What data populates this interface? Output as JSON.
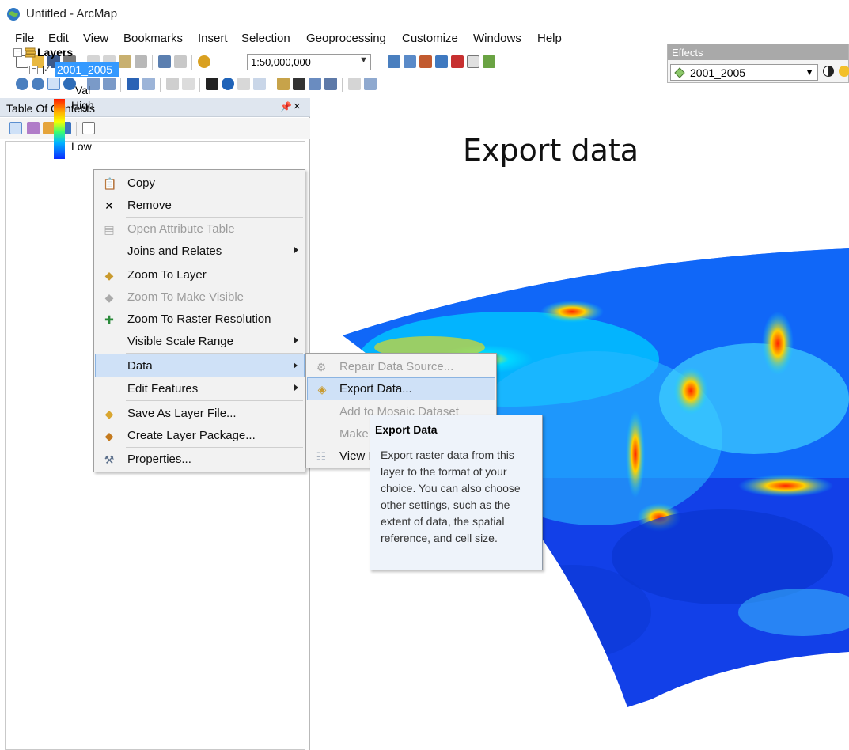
{
  "window": {
    "title": "Untitled - ArcMap"
  },
  "menubar": [
    "File",
    "Edit",
    "View",
    "Bookmarks",
    "Insert",
    "Selection",
    "Geoprocessing",
    "Customize",
    "Windows",
    "Help"
  ],
  "toolbar": {
    "scale": "1:50,000,000"
  },
  "effects": {
    "title": "Effects",
    "layer": "2001_2005"
  },
  "toc": {
    "title": "Table Of Contents",
    "pin": "✂",
    "close": "×",
    "root_label": "Layers",
    "layer_name": "2001_2005",
    "legend_value_label": "Val",
    "legend_high": "High",
    "legend_low": "Low"
  },
  "map": {
    "heading": "Export data"
  },
  "context_menu": {
    "items": [
      {
        "label": "Copy",
        "icon": "copy-icon",
        "enabled": true
      },
      {
        "label": "Remove",
        "icon": "remove-icon",
        "enabled": true
      },
      {
        "label": "Open Attribute Table",
        "icon": "table-icon",
        "enabled": false
      },
      {
        "label": "Joins and Relates",
        "icon": "",
        "enabled": true,
        "submenu": true
      },
      {
        "label": "Zoom To Layer",
        "icon": "zoom-layer-icon",
        "enabled": true
      },
      {
        "label": "Zoom To Make Visible",
        "icon": "zoom-visible-icon",
        "enabled": false
      },
      {
        "label": "Zoom To Raster Resolution",
        "icon": "zoom-raster-icon",
        "enabled": true
      },
      {
        "label": "Visible Scale Range",
        "icon": "",
        "enabled": true,
        "submenu": true
      },
      {
        "label": "Data",
        "icon": "",
        "enabled": true,
        "submenu": true,
        "highlighted": true
      },
      {
        "label": "Edit Features",
        "icon": "",
        "enabled": true,
        "submenu": true
      },
      {
        "label": "Save As Layer File...",
        "icon": "save-layer-icon",
        "enabled": true
      },
      {
        "label": "Create Layer Package...",
        "icon": "layer-package-icon",
        "enabled": true
      },
      {
        "label": "Properties...",
        "icon": "properties-icon",
        "enabled": true
      }
    ]
  },
  "data_submenu": {
    "items": [
      {
        "label": "Repair Data Source...",
        "enabled": false
      },
      {
        "label": "Export Data...",
        "enabled": true,
        "highlighted": true
      },
      {
        "label": "Add to Mosaic Dataset",
        "enabled": false
      },
      {
        "label": "Make",
        "enabled": false
      },
      {
        "label": "View I",
        "enabled": true
      }
    ]
  },
  "tooltip": {
    "title": "Export Data",
    "body": "Export raster data from this layer to the format of your choice. You can also choose other settings, such as the extent of data, the spatial reference, and cell size."
  }
}
